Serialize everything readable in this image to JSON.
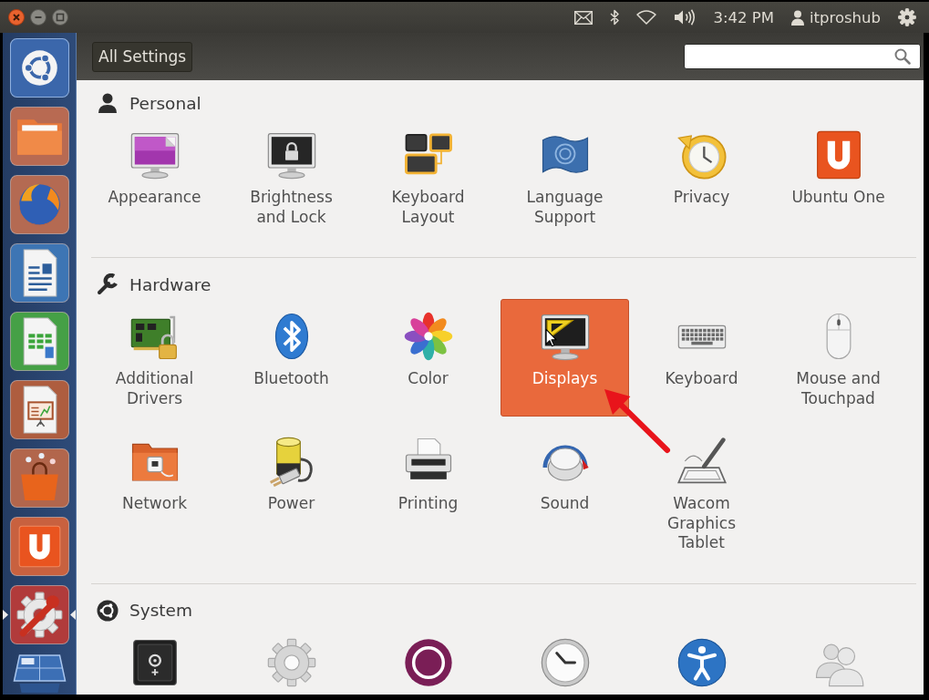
{
  "top_panel": {
    "time": "3:42 PM",
    "user": "itproshub"
  },
  "launcher": {
    "apps": [
      {
        "running": false,
        "active": false
      },
      {
        "running": false,
        "active": false
      },
      {
        "running": false,
        "active": false
      },
      {
        "running": false,
        "active": false
      },
      {
        "running": false,
        "active": false
      },
      {
        "running": false,
        "active": false
      },
      {
        "running": false,
        "active": false
      },
      {
        "running": true,
        "active": true
      }
    ]
  },
  "toolbar": {
    "back_button": "All Settings"
  },
  "sections": [
    {
      "title": "Personal",
      "items": [
        {
          "label": "Appearance",
          "selected": false
        },
        {
          "label": "Brightness and Lock",
          "selected": false
        },
        {
          "label": "Keyboard Layout",
          "selected": false
        },
        {
          "label": "Language Support",
          "selected": false
        },
        {
          "label": "Privacy",
          "selected": false
        },
        {
          "label": "Ubuntu One",
          "selected": false
        }
      ]
    },
    {
      "title": "Hardware",
      "items": [
        {
          "label": "Additional Drivers",
          "selected": false
        },
        {
          "label": "Bluetooth",
          "selected": false
        },
        {
          "label": "Color",
          "selected": false
        },
        {
          "label": "Displays",
          "selected": true
        },
        {
          "label": "Keyboard",
          "selected": false
        },
        {
          "label": "Mouse and Touchpad",
          "selected": false
        },
        {
          "label": "Network",
          "selected": false
        },
        {
          "label": "Power",
          "selected": false
        },
        {
          "label": "Printing",
          "selected": false
        },
        {
          "label": "Sound",
          "selected": false
        },
        {
          "label": "Wacom Graphics Tablet",
          "selected": false
        }
      ]
    },
    {
      "title": "System",
      "items": [
        {
          "selected": false
        },
        {
          "selected": false
        },
        {
          "selected": false
        },
        {
          "selected": false
        },
        {
          "selected": false
        },
        {
          "selected": false
        }
      ]
    }
  ]
}
